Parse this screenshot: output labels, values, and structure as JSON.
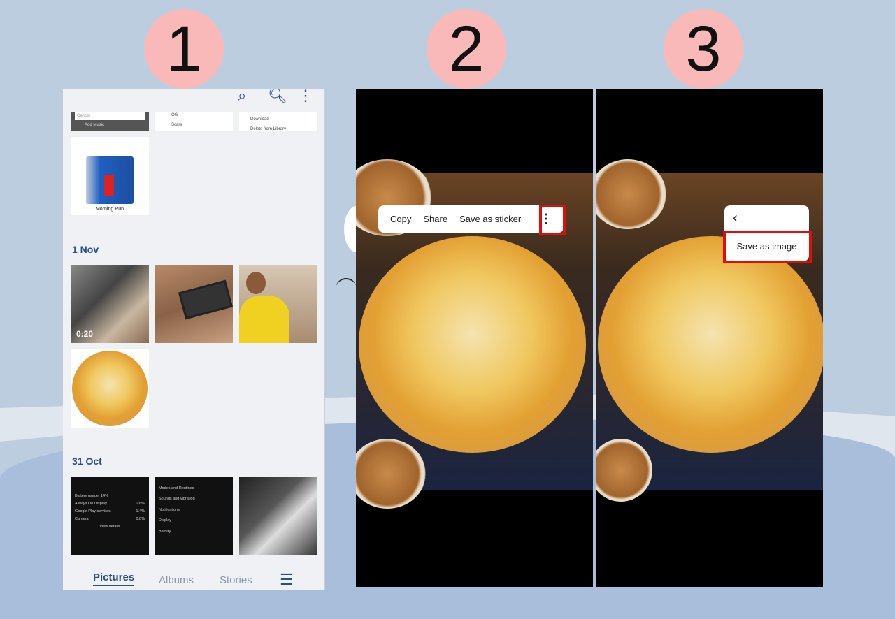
{
  "steps": [
    "1",
    "2",
    "3"
  ],
  "panel1": {
    "top_icons": [
      "sticker-search-icon",
      "search-icon",
      "more-icon"
    ],
    "cards": {
      "cancel": "Cancel",
      "add_music": "Add Music",
      "song1": "OG",
      "song2": "Scars",
      "download": "Download",
      "delete": "Delete from Library",
      "morning_run": "Morning Run"
    },
    "sections": [
      {
        "date": "1 Nov"
      },
      {
        "date": "31 Oct"
      }
    ],
    "video_duration": "0:20",
    "battery_thumb": {
      "usage": "Battery usage: 14%",
      "items": [
        {
          "name": "Always On Display",
          "value": "1.6%"
        },
        {
          "name": "Google Play services",
          "value": "1.4%"
        },
        {
          "name": "Camera",
          "value": "0.8%"
        }
      ],
      "view": "View details"
    },
    "settings_thumb": [
      "Modes and Routines",
      "Sounds and vibration",
      "Notifications",
      "Display",
      "Battery"
    ],
    "nav": {
      "pictures": "Pictures",
      "albums": "Albums",
      "stories": "Stories",
      "menu_icon": "hamburger-menu-icon"
    },
    "active_tab": "Pictures"
  },
  "panel2": {
    "menu": {
      "copy": "Copy",
      "share": "Share",
      "save_sticker": "Save as sticker"
    },
    "more_icon": "vertical-dots-icon"
  },
  "panel3": {
    "back_icon": "chevron-left-icon",
    "save_image": "Save as image"
  },
  "colors": {
    "highlight": "#e10d0d",
    "step_circle": "#f9b9b9",
    "accent": "#2a4e86"
  }
}
